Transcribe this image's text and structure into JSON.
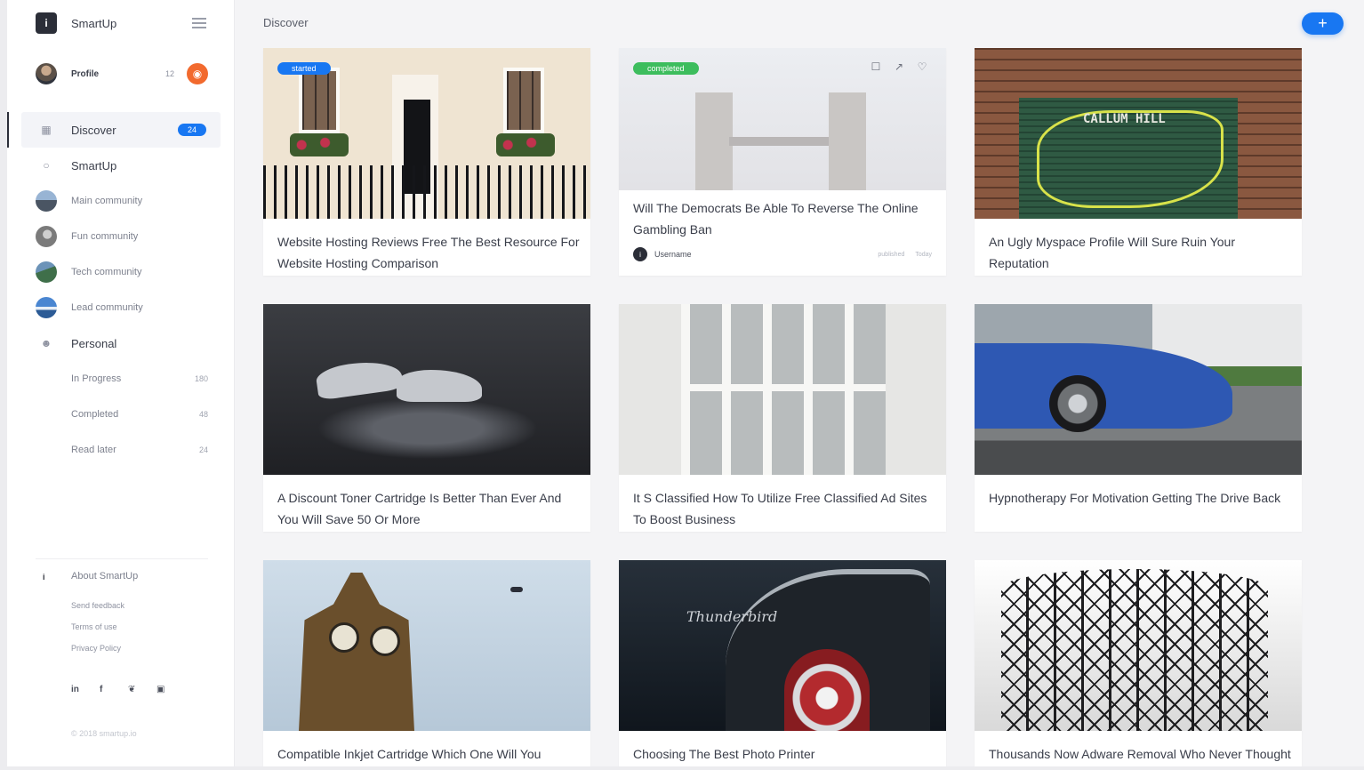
{
  "app": {
    "name": "SmartUp",
    "logo_glyph": "i",
    "accent_color": "#1877f2"
  },
  "profile": {
    "name": "Profile",
    "count": "12",
    "notification_icon": "bell-icon"
  },
  "sidebar": {
    "discover": {
      "label": "Discover",
      "badge": "24",
      "icon": "grid-icon"
    },
    "smartup": {
      "label": "SmartUp",
      "icon": "circle-icon"
    },
    "communities": [
      {
        "label": "Main community"
      },
      {
        "label": "Fun community"
      },
      {
        "label": "Tech community"
      },
      {
        "label": "Lead community"
      }
    ],
    "personal": {
      "label": "Personal",
      "icon": "user-icon"
    },
    "personal_items": [
      {
        "label": "In Progress",
        "count": "180"
      },
      {
        "label": "Completed",
        "count": "48"
      },
      {
        "label": "Read later",
        "count": "24"
      }
    ],
    "about": "About SmartUp",
    "links": [
      "Send feedback",
      "Terms of use",
      "Privacy Policy"
    ],
    "socials": [
      {
        "label": "in",
        "icon": "linkedin-icon"
      },
      {
        "label": "f",
        "icon": "facebook-icon"
      },
      {
        "label": "❦",
        "icon": "twitter-icon"
      },
      {
        "label": "▣",
        "icon": "instagram-icon"
      }
    ],
    "copyright": "© 2018 smartup.io"
  },
  "main": {
    "title": "Discover",
    "add_button": "+"
  },
  "cards": [
    {
      "title": "Website Hosting Reviews Free The Best Resource For Website Hosting Comparison",
      "tag": "started",
      "tag_color": "#1877f2"
    },
    {
      "title": "Will The Democrats Be Able To Reverse The Online Gambling Ban",
      "tag": "completed",
      "tag_color": "#3dbd5d",
      "user": "Username",
      "status": "published",
      "date": "Today"
    },
    {
      "title": "An Ugly Myspace Profile Will Sure Ruin Your Reputation",
      "graffiti_text": "CALLUM HILL"
    },
    {
      "title": "A Discount Toner Cartridge Is Better Than Ever And You Will Save 50 Or More"
    },
    {
      "title": "It S Classified How To Utilize Free Classified Ad Sites To Boost Business"
    },
    {
      "title": "Hypnotherapy For Motivation Getting The Drive Back"
    },
    {
      "title": "Compatible Inkjet Cartridge Which One Will You Choose"
    },
    {
      "title": "Choosing The Best Photo Printer",
      "script_text": "Thunderbird"
    },
    {
      "title": "Thousands Now Adware Removal Who Never Thought They Could"
    }
  ]
}
